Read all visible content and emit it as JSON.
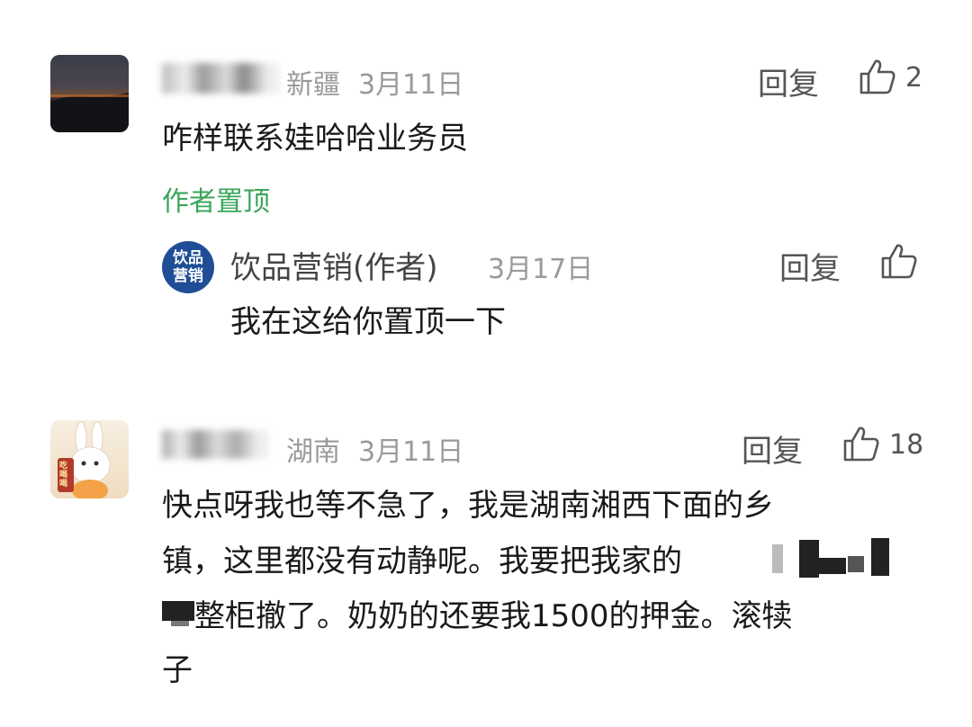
{
  "comments": [
    {
      "username_redacted": "",
      "location": "新疆",
      "date": "3月11日",
      "reply_label": "回复",
      "likes": "2",
      "text": "咋样联系娃哈哈业务员",
      "pinned_label": "作者置顶",
      "replies": [
        {
          "avatar_text_1": "饮品",
          "avatar_text_2": "营销",
          "username": "饮品营销(作者)",
          "date": "3月17日",
          "reply_label": "回复",
          "text": "我在这给你置顶一下"
        }
      ]
    },
    {
      "username_redacted": "",
      "location": "湖南",
      "date": "3月11日",
      "reply_label": "回复",
      "likes": "18",
      "text_line1": "快点呀我也等不急了，我是湖南湘西下面的乡",
      "text_line2": "镇，这里都没有动静呢。我要把我家的",
      "text_line3": "整柜撤了。奶奶的还要我1500的押金。滚犊",
      "text_line4": "子",
      "avatar_badge": "吃喝喝"
    }
  ],
  "colors": {
    "pinned_green": "#3aa55a",
    "reply_avatar_blue": "#1f4e96",
    "meta_gray": "#9a9a9a"
  }
}
